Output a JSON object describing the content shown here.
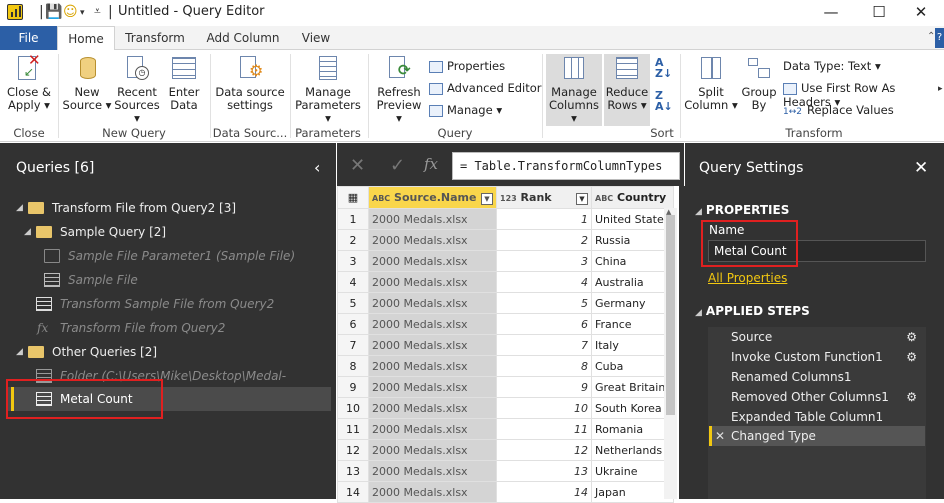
{
  "window": {
    "title": "Untitled - Query Editor",
    "controls": [
      "—",
      "☐",
      "✕"
    ]
  },
  "tabs": [
    "File",
    "Home",
    "Transform",
    "Add Column",
    "View"
  ],
  "ribbon": {
    "close_apply": [
      "Close &",
      "Apply ▾"
    ],
    "new_source": [
      "New",
      "Source ▾"
    ],
    "recent_sources": [
      "Recent",
      "Sources ▾"
    ],
    "enter_data": [
      "Enter",
      "Data"
    ],
    "data_source_settings": [
      "Data source",
      "settings"
    ],
    "manage_parameters": [
      "Manage",
      "Parameters ▾"
    ],
    "refresh_preview": [
      "Refresh",
      "Preview ▾"
    ],
    "properties": "Properties",
    "advanced_editor": "Advanced Editor",
    "manage": "Manage ▾",
    "manage_columns": [
      "Manage",
      "Columns ▾"
    ],
    "reduce_rows": [
      "Reduce",
      "Rows ▾"
    ],
    "split_column": [
      "Split",
      "Column ▾"
    ],
    "group_by": [
      "Group",
      "By"
    ],
    "data_type": "Data Type: Text ▾",
    "use_first_row": "Use First Row As Headers ▾",
    "replace_values": "Replace Values",
    "sort_label": "Sort",
    "groups": {
      "close": "Close",
      "new_query": "New Query",
      "data_sources": "Data Sourc...",
      "parameters": "Parameters",
      "query": "Query",
      "sort": "Sort",
      "transform": "Transform"
    }
  },
  "queries": {
    "header": "Queries [6]",
    "items": [
      {
        "label": "Transform File from Query2 [3]"
      },
      {
        "label": "Sample Query [2]"
      },
      {
        "label": "Sample File Parameter1 (Sample File)"
      },
      {
        "label": "Sample File"
      },
      {
        "label": "Transform Sample File from Query2"
      },
      {
        "label": "Transform File from Query2"
      },
      {
        "label": "Other Queries [2]"
      },
      {
        "label": "Folder (C:\\Users\\Mike\\Desktop\\Medal-Counts)"
      },
      {
        "label": "Metal Count"
      }
    ]
  },
  "formula": "= Table.TransformColumnTypes",
  "table": {
    "headers": [
      "Source.Name",
      "Rank",
      "Country"
    ],
    "header_types": [
      "ABC",
      "123",
      "ABC"
    ],
    "rows": [
      [
        "1",
        "2000 Medals.xlsx",
        "1",
        "United States"
      ],
      [
        "2",
        "2000 Medals.xlsx",
        "2",
        "Russia"
      ],
      [
        "3",
        "2000 Medals.xlsx",
        "3",
        "China"
      ],
      [
        "4",
        "2000 Medals.xlsx",
        "4",
        "Australia"
      ],
      [
        "5",
        "2000 Medals.xlsx",
        "5",
        "Germany"
      ],
      [
        "6",
        "2000 Medals.xlsx",
        "6",
        "France"
      ],
      [
        "7",
        "2000 Medals.xlsx",
        "7",
        "Italy"
      ],
      [
        "8",
        "2000 Medals.xlsx",
        "8",
        "Cuba"
      ],
      [
        "9",
        "2000 Medals.xlsx",
        "9",
        "Great Britain"
      ],
      [
        "10",
        "2000 Medals.xlsx",
        "10",
        "South Korea"
      ],
      [
        "11",
        "2000 Medals.xlsx",
        "11",
        "Romania"
      ],
      [
        "12",
        "2000 Medals.xlsx",
        "12",
        "Netherlands"
      ],
      [
        "13",
        "2000 Medals.xlsx",
        "13",
        "Ukraine"
      ],
      [
        "14",
        "2000 Medals.xlsx",
        "14",
        "Japan"
      ]
    ]
  },
  "settings": {
    "title": "Query Settings",
    "properties": "PROPERTIES",
    "name_label": "Name",
    "name_value": "Metal Count",
    "all_properties": "All Properties",
    "applied_steps": "APPLIED STEPS",
    "steps": [
      "Source",
      "Invoke Custom Function1",
      "Renamed Columns1",
      "Removed Other Columns1",
      "Expanded Table Column1",
      "Changed Type"
    ]
  },
  "colors": {
    "accent": "#f2c811",
    "file_tab": "#2c5fa6",
    "panel": "#323232",
    "highlight": "#e02020"
  }
}
